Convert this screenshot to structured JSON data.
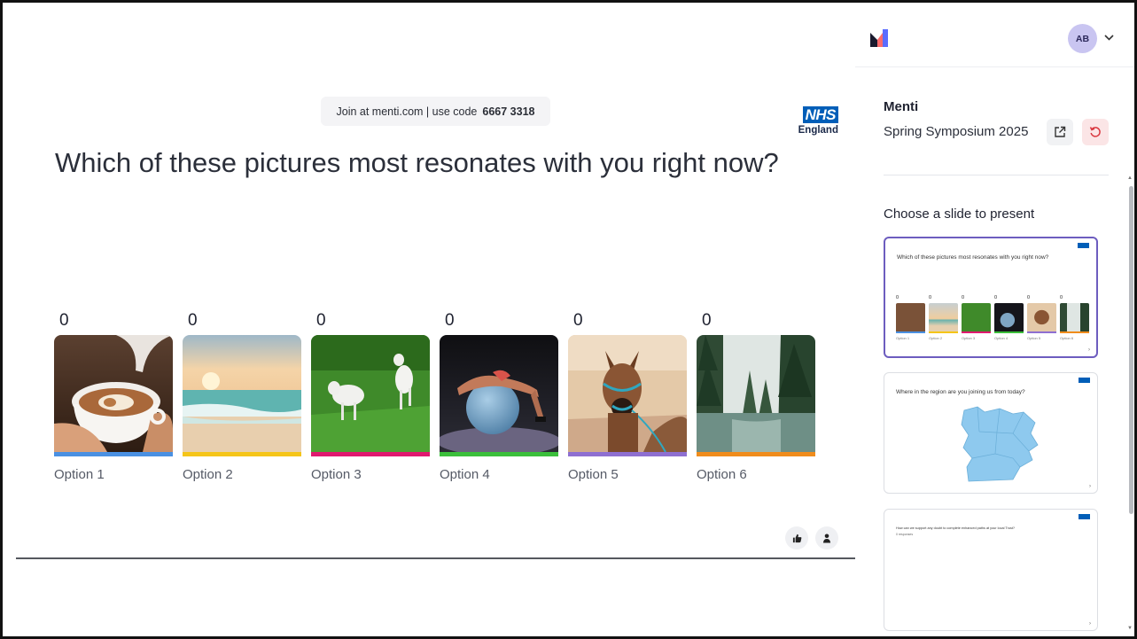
{
  "slide": {
    "join_prefix": "Join at menti.com | use code",
    "join_code": "6667 3318",
    "logo_main": "NHS",
    "logo_sub": "England",
    "question": "Which of these pictures most resonates with you right now?",
    "options": [
      {
        "count": "0",
        "label": "Option 1",
        "image": "latte-art-cup",
        "bar_color": "#4a90e2"
      },
      {
        "count": "0",
        "label": "Option 2",
        "image": "beach-sunset",
        "bar_color": "#f5c518"
      },
      {
        "count": "0",
        "label": "Option 3",
        "image": "lambs-on-grass",
        "bar_color": "#e0196f"
      },
      {
        "count": "0",
        "label": "Option 4",
        "image": "stretch-on-exercise-ball",
        "bar_color": "#3bbf3b"
      },
      {
        "count": "0",
        "label": "Option 5",
        "image": "alpaca",
        "bar_color": "#8e6fd1"
      },
      {
        "count": "0",
        "label": "Option 6",
        "image": "forest-lake",
        "bar_color": "#f08c1c"
      }
    ],
    "reactions": [
      "thumbs-up-icon",
      "person-icon"
    ]
  },
  "panel": {
    "avatar_initials": "AB",
    "owner": "Menti",
    "presentation_name": "Spring Symposium 2025",
    "choose_heading": "Choose a slide to present",
    "thumbnails": [
      {
        "question": "Which of these pictures most resonates with you right now?",
        "active": true
      },
      {
        "question": "Where in the region are you joining us from today?",
        "active": false
      },
      {
        "question": "How can we support any doubt to complete enhanced paths at your local Trust?",
        "sub": "0 responses",
        "active": false
      }
    ]
  },
  "colors": {
    "accent_purple": "#6d5dbf",
    "nhs_blue": "#005eb8",
    "avatar_bg": "#c9c5f1"
  }
}
